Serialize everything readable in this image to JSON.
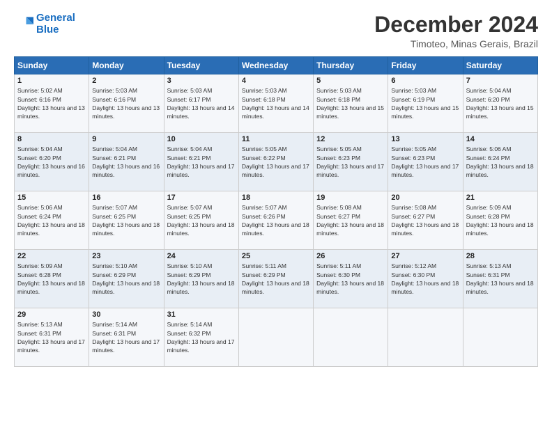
{
  "logo": {
    "line1": "General",
    "line2": "Blue"
  },
  "title": "December 2024",
  "location": "Timoteo, Minas Gerais, Brazil",
  "weekdays": [
    "Sunday",
    "Monday",
    "Tuesday",
    "Wednesday",
    "Thursday",
    "Friday",
    "Saturday"
  ],
  "weeks": [
    [
      {
        "day": "1",
        "sunrise": "5:02 AM",
        "sunset": "6:16 PM",
        "daylight": "13 hours and 13 minutes."
      },
      {
        "day": "2",
        "sunrise": "5:03 AM",
        "sunset": "6:16 PM",
        "daylight": "13 hours and 13 minutes."
      },
      {
        "day": "3",
        "sunrise": "5:03 AM",
        "sunset": "6:17 PM",
        "daylight": "13 hours and 14 minutes."
      },
      {
        "day": "4",
        "sunrise": "5:03 AM",
        "sunset": "6:18 PM",
        "daylight": "13 hours and 14 minutes."
      },
      {
        "day": "5",
        "sunrise": "5:03 AM",
        "sunset": "6:18 PM",
        "daylight": "13 hours and 15 minutes."
      },
      {
        "day": "6",
        "sunrise": "5:03 AM",
        "sunset": "6:19 PM",
        "daylight": "13 hours and 15 minutes."
      },
      {
        "day": "7",
        "sunrise": "5:04 AM",
        "sunset": "6:20 PM",
        "daylight": "13 hours and 15 minutes."
      }
    ],
    [
      {
        "day": "8",
        "sunrise": "5:04 AM",
        "sunset": "6:20 PM",
        "daylight": "13 hours and 16 minutes."
      },
      {
        "day": "9",
        "sunrise": "5:04 AM",
        "sunset": "6:21 PM",
        "daylight": "13 hours and 16 minutes."
      },
      {
        "day": "10",
        "sunrise": "5:04 AM",
        "sunset": "6:21 PM",
        "daylight": "13 hours and 17 minutes."
      },
      {
        "day": "11",
        "sunrise": "5:05 AM",
        "sunset": "6:22 PM",
        "daylight": "13 hours and 17 minutes."
      },
      {
        "day": "12",
        "sunrise": "5:05 AM",
        "sunset": "6:23 PM",
        "daylight": "13 hours and 17 minutes."
      },
      {
        "day": "13",
        "sunrise": "5:05 AM",
        "sunset": "6:23 PM",
        "daylight": "13 hours and 17 minutes."
      },
      {
        "day": "14",
        "sunrise": "5:06 AM",
        "sunset": "6:24 PM",
        "daylight": "13 hours and 18 minutes."
      }
    ],
    [
      {
        "day": "15",
        "sunrise": "5:06 AM",
        "sunset": "6:24 PM",
        "daylight": "13 hours and 18 minutes."
      },
      {
        "day": "16",
        "sunrise": "5:07 AM",
        "sunset": "6:25 PM",
        "daylight": "13 hours and 18 minutes."
      },
      {
        "day": "17",
        "sunrise": "5:07 AM",
        "sunset": "6:25 PM",
        "daylight": "13 hours and 18 minutes."
      },
      {
        "day": "18",
        "sunrise": "5:07 AM",
        "sunset": "6:26 PM",
        "daylight": "13 hours and 18 minutes."
      },
      {
        "day": "19",
        "sunrise": "5:08 AM",
        "sunset": "6:27 PM",
        "daylight": "13 hours and 18 minutes."
      },
      {
        "day": "20",
        "sunrise": "5:08 AM",
        "sunset": "6:27 PM",
        "daylight": "13 hours and 18 minutes."
      },
      {
        "day": "21",
        "sunrise": "5:09 AM",
        "sunset": "6:28 PM",
        "daylight": "13 hours and 18 minutes."
      }
    ],
    [
      {
        "day": "22",
        "sunrise": "5:09 AM",
        "sunset": "6:28 PM",
        "daylight": "13 hours and 18 minutes."
      },
      {
        "day": "23",
        "sunrise": "5:10 AM",
        "sunset": "6:29 PM",
        "daylight": "13 hours and 18 minutes."
      },
      {
        "day": "24",
        "sunrise": "5:10 AM",
        "sunset": "6:29 PM",
        "daylight": "13 hours and 18 minutes."
      },
      {
        "day": "25",
        "sunrise": "5:11 AM",
        "sunset": "6:29 PM",
        "daylight": "13 hours and 18 minutes."
      },
      {
        "day": "26",
        "sunrise": "5:11 AM",
        "sunset": "6:30 PM",
        "daylight": "13 hours and 18 minutes."
      },
      {
        "day": "27",
        "sunrise": "5:12 AM",
        "sunset": "6:30 PM",
        "daylight": "13 hours and 18 minutes."
      },
      {
        "day": "28",
        "sunrise": "5:13 AM",
        "sunset": "6:31 PM",
        "daylight": "13 hours and 18 minutes."
      }
    ],
    [
      {
        "day": "29",
        "sunrise": "5:13 AM",
        "sunset": "6:31 PM",
        "daylight": "13 hours and 17 minutes."
      },
      {
        "day": "30",
        "sunrise": "5:14 AM",
        "sunset": "6:31 PM",
        "daylight": "13 hours and 17 minutes."
      },
      {
        "day": "31",
        "sunrise": "5:14 AM",
        "sunset": "6:32 PM",
        "daylight": "13 hours and 17 minutes."
      },
      null,
      null,
      null,
      null
    ]
  ]
}
